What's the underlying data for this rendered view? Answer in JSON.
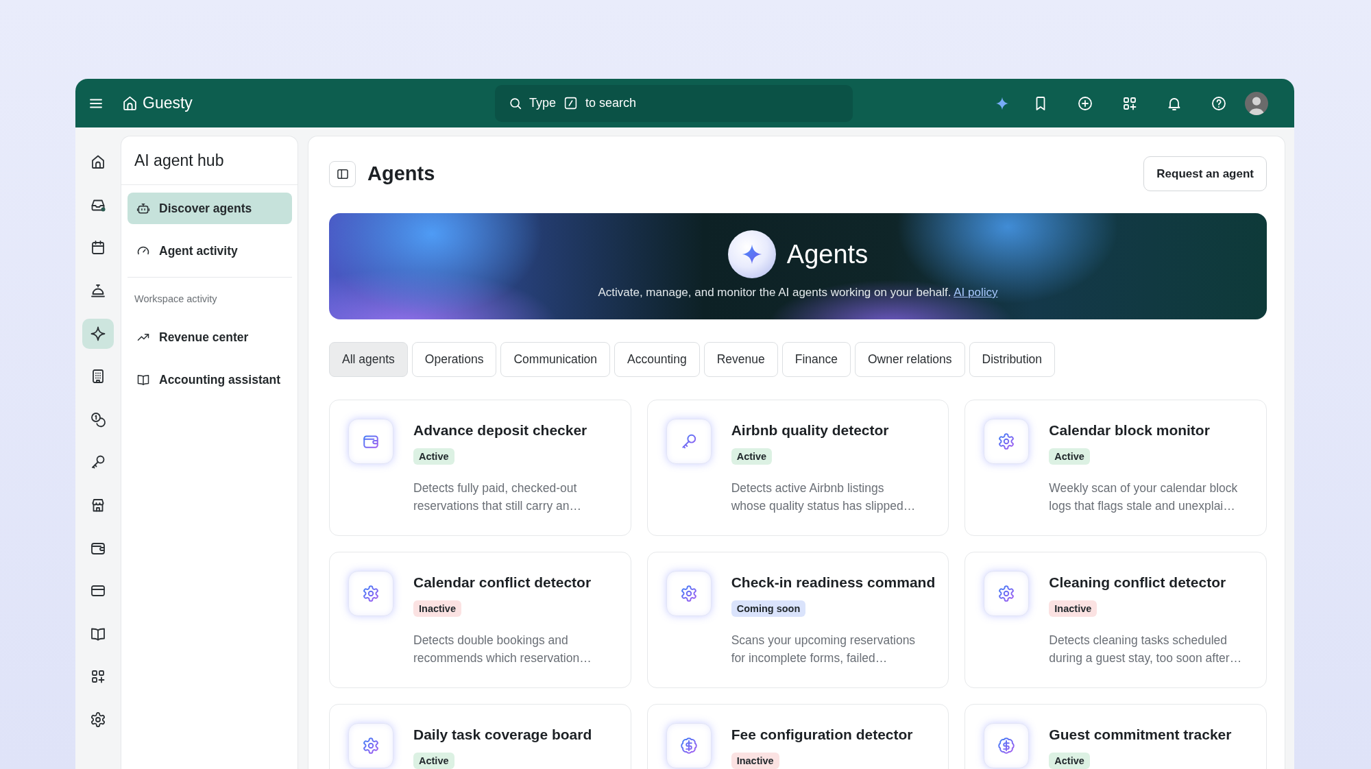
{
  "top_bar": {
    "brand": "Guesty",
    "search": {
      "placeholder": [
        "Type",
        "to search"
      ]
    },
    "actions": [
      {
        "kind": "assistant"
      },
      {
        "kind": "bookmark"
      },
      {
        "kind": "create"
      },
      {
        "kind": "apps"
      },
      {
        "kind": "bell"
      },
      {
        "kind": "help"
      },
      {
        "kind": "profile"
      }
    ]
  },
  "rail": [
    {
      "kind": "home",
      "selected": false
    },
    {
      "kind": "inbox",
      "selected": false
    },
    {
      "kind": "calendar",
      "selected": false
    },
    {
      "kind": "concierge",
      "selected": false
    },
    {
      "kind": "agents",
      "selected": true
    },
    {
      "kind": "building",
      "selected": false
    },
    {
      "kind": "finance",
      "selected": false
    },
    {
      "kind": "key",
      "selected": false
    },
    {
      "kind": "store",
      "selected": false
    },
    {
      "kind": "wallet",
      "selected": false
    },
    {
      "kind": "card",
      "selected": false
    },
    {
      "kind": "book",
      "selected": false
    },
    {
      "kind": "apps",
      "selected": false
    },
    {
      "kind": "settings",
      "selected": false
    }
  ],
  "hub_panel": {
    "title": "AI agent hub",
    "items": [
      {
        "label": "Discover agents",
        "kind": "robot",
        "selected": true
      },
      {
        "label": "Agent activity",
        "kind": "gauge",
        "selected": false
      }
    ],
    "section": {
      "heading": "Workspace activity",
      "items": [
        {
          "label": "Revenue center",
          "kind": "trend",
          "selected": false
        },
        {
          "label": "Accounting assistant",
          "kind": "book",
          "selected": false
        }
      ]
    }
  },
  "page": {
    "title": "Agents",
    "request_button": "Request an agent"
  },
  "banner": {
    "title": "Agents",
    "text": "Activate, manage, and monitor the AI agents working on your behalf.",
    "link": "AI policy"
  },
  "tabs": [
    {
      "label": "All agents",
      "selected": true
    },
    {
      "label": "Operations",
      "selected": false
    },
    {
      "label": "Communication",
      "selected": false
    },
    {
      "label": "Accounting",
      "selected": false
    },
    {
      "label": "Revenue",
      "selected": false
    },
    {
      "label": "Finance",
      "selected": false
    },
    {
      "label": "Owner relations",
      "selected": false
    },
    {
      "label": "Distribution",
      "selected": false
    }
  ],
  "agents": [
    {
      "name": "Advance deposit checker",
      "kind": "wallet",
      "status": {
        "label": "Active",
        "color": "#dcf1e3"
      },
      "description": [
        "Detects fully paid, checked-out",
        "reservations that still carry an…"
      ]
    },
    {
      "name": "Airbnb quality detector",
      "kind": "key",
      "status": {
        "label": "Active",
        "color": "#dcf1e3"
      },
      "description": [
        "Detects active Airbnb listings",
        "whose quality status has slipped…"
      ]
    },
    {
      "name": "Calendar block monitor",
      "kind": "gear",
      "status": {
        "label": "Active",
        "color": "#dcf1e3"
      },
      "description": [
        "Weekly scan of your calendar block",
        "logs that flags stale and unexplai…"
      ]
    },
    {
      "name": "Calendar conflict detector",
      "kind": "gear",
      "status": {
        "label": "Inactive",
        "color": "#fbe2e2"
      },
      "description": [
        "Detects double bookings and",
        "recommends which reservation…"
      ]
    },
    {
      "name": "Check-in readiness command",
      "kind": "gear",
      "status": {
        "label": "Coming soon",
        "color": "#dae3fb"
      },
      "description": [
        "Scans your upcoming reservations",
        "for incomplete forms, failed…"
      ]
    },
    {
      "name": "Cleaning conflict detector",
      "kind": "gear",
      "status": {
        "label": "Inactive",
        "color": "#fbe2e2"
      },
      "description": [
        "Detects cleaning tasks scheduled",
        "during a guest stay, too soon after…"
      ]
    },
    {
      "name": "Daily task coverage board",
      "kind": "gear",
      "status": {
        "label": "Active",
        "color": "#dcf1e3"
      }
    },
    {
      "name": "Fee configuration detector",
      "kind": "dollar",
      "status": {
        "label": "Inactive",
        "color": "#fbe2e2"
      }
    },
    {
      "name": "Guest commitment tracker",
      "kind": "dollar",
      "status": {
        "label": "Active",
        "color": "#dcf1e3"
      }
    }
  ]
}
